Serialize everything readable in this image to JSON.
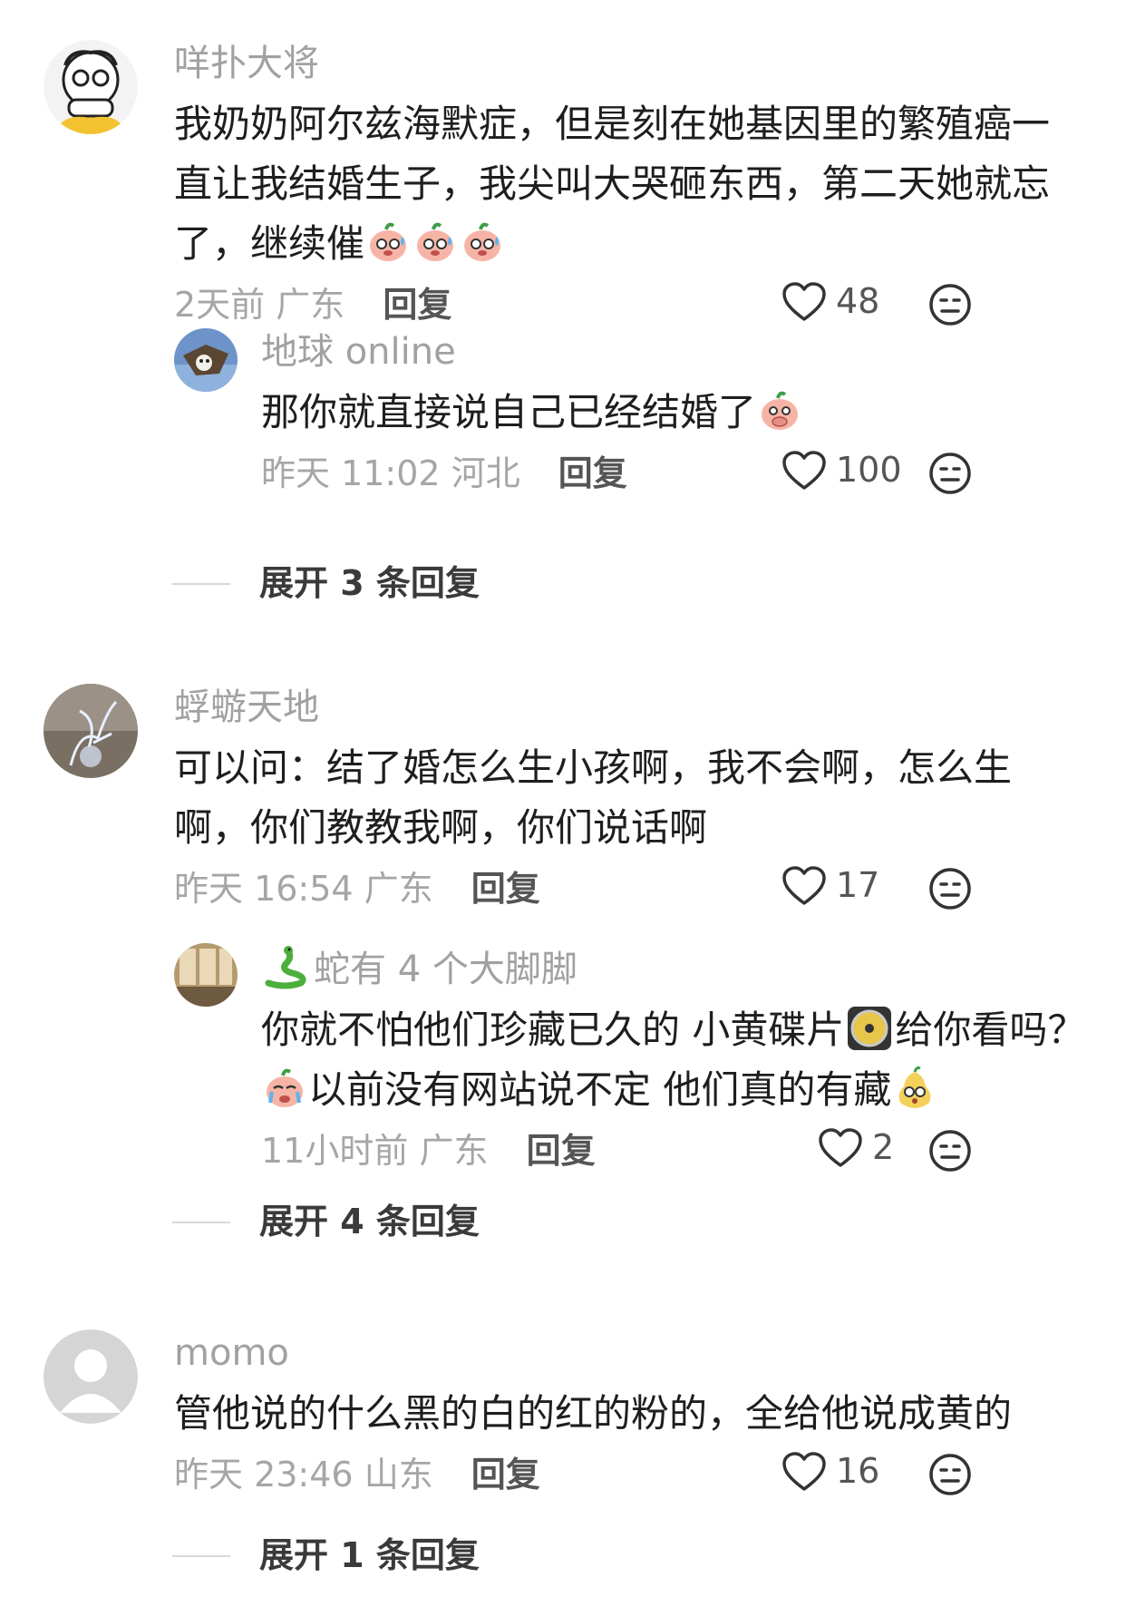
{
  "comments": [
    {
      "username": "咩扑大将",
      "text_parts": [
        "我奶奶阿尔兹海默症，但是刻在她基因里的繁殖癌一直让我结婚生子，我尖叫大哭砸东西，第二天她就忘了，继续催"
      ],
      "emojis": [
        "sweating-peach-emoji",
        "sweating-peach-emoji",
        "sweating-peach-emoji"
      ],
      "time": "2天前",
      "location": "广东",
      "reply_label": "回复",
      "likes": "48",
      "replies": [
        {
          "username": "地球 online",
          "text": "那你就直接说自己已经结婚了",
          "emoji": "covering-mouth-peach-emoji",
          "time": "昨天 11:02",
          "location": "河北",
          "reply_label": "回复",
          "likes": "100"
        }
      ],
      "expand_label": "展开 3 条回复"
    },
    {
      "username": "蜉蝣天地",
      "text": "可以问：结了婚怎么生小孩啊，我不会啊，怎么生啊，你们教教我啊，你们说话啊",
      "time": "昨天 16:54",
      "location": "广东",
      "reply_label": "回复",
      "likes": "17",
      "replies": [
        {
          "username_prefix_emoji": "snake-emoji",
          "username": "蛇有 4 个大脚脚",
          "text_a": "你就不怕他们珍藏已久的 小黄碟片",
          "text_b": "给你看吗？",
          "text_c": "以前没有网站说不定 他们真的有藏",
          "time": "11小时前",
          "location": "广东",
          "reply_label": "回复",
          "likes": "2"
        }
      ],
      "expand_label": "展开 4 条回复"
    },
    {
      "username": "momo",
      "text": "管他说的什么黑的白的红的粉的，全给他说成黄的",
      "time": "昨天 23:46",
      "location": "山东",
      "reply_label": "回复",
      "likes": "16",
      "expand_label": "展开 1 条回复"
    }
  ],
  "colors": {
    "username": "#a1a1a1",
    "text": "#1e1e1e",
    "meta": "#a6a6a6",
    "action": "#555555"
  }
}
